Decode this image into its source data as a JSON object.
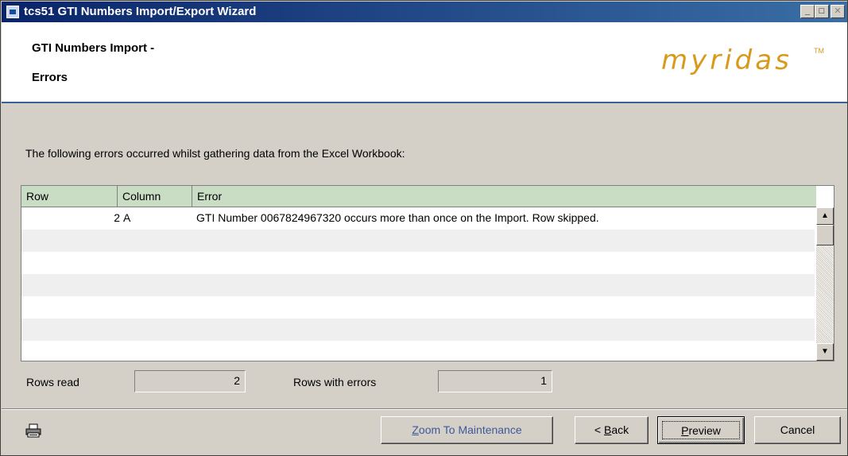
{
  "window": {
    "title": "tcs51 GTI Numbers Import/Export Wizard"
  },
  "header": {
    "title_line1": "GTI Numbers Import -",
    "title_line2": "Errors",
    "logo": "myridas",
    "logo_tm": "TM"
  },
  "instructions": "The following errors occurred whilst gathering data from the Excel Workbook:",
  "grid": {
    "columns": [
      "Row",
      "Column",
      "Error"
    ],
    "rows": [
      {
        "row": "2",
        "column": "A",
        "error": "GTI Number 0067824967320 occurs more than once on the Import. Row skipped."
      }
    ]
  },
  "stats": {
    "rows_read_label": "Rows read",
    "rows_read_value": "2",
    "rows_with_errors_label": "Rows with errors",
    "rows_with_errors_value": "1"
  },
  "buttons": {
    "zoom_prefix": "Z",
    "zoom_rest": "oom To Maintenance",
    "back_prefix": "< ",
    "back_key": "B",
    "back_rest": "ack",
    "preview_key": "P",
    "preview_rest": "review",
    "cancel": "Cancel"
  },
  "icons": {
    "app": "wizard-app-icon",
    "printer": "printer-icon"
  }
}
